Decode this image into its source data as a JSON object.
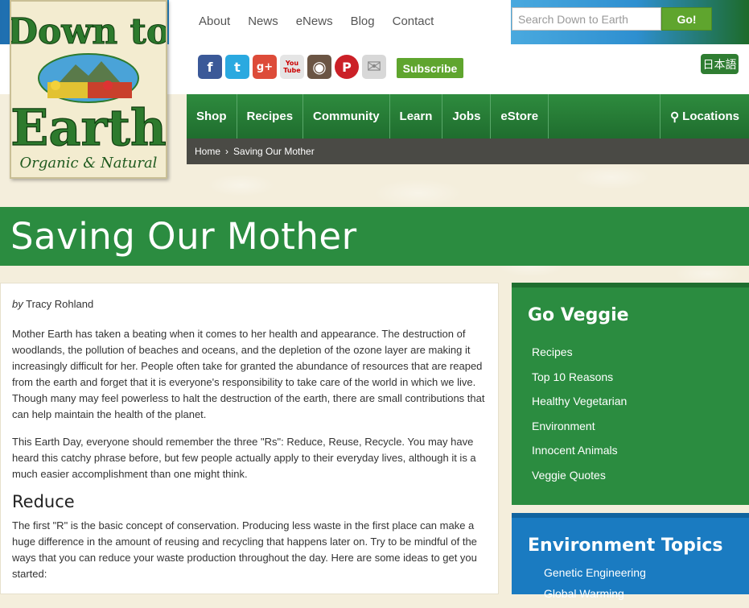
{
  "header": {
    "logo": {
      "line1": "Down to",
      "line2": "Earth",
      "tagline": "Organic & Natural"
    },
    "topnav": [
      "About",
      "News",
      "eNews",
      "Blog",
      "Contact"
    ],
    "search": {
      "placeholder": "Search Down to Earth",
      "button": "Go!"
    },
    "socials": [
      {
        "icon": "facebook-icon",
        "glyph": "f",
        "color": "#3b5998"
      },
      {
        "icon": "twitter-icon",
        "glyph": "t",
        "color": "#2aa9e0"
      },
      {
        "icon": "google-plus-icon",
        "glyph": "g+",
        "color": "#dd4b39"
      },
      {
        "icon": "youtube-icon",
        "glyph": "You Tube",
        "color": "#e5e5e5"
      },
      {
        "icon": "instagram-icon",
        "glyph": "◉",
        "color": "#6b5544"
      },
      {
        "icon": "pinterest-icon",
        "glyph": "P",
        "color": "#cb2027"
      },
      {
        "icon": "email-icon",
        "glyph": "✉",
        "color": "#d8d8d8"
      }
    ],
    "subscribe": "Subscribe",
    "language": "日本語"
  },
  "mainnav": {
    "items": [
      "Shop",
      "Recipes",
      "Community",
      "Learn",
      "Jobs",
      "eStore"
    ],
    "locations": "Locations"
  },
  "breadcrumb": {
    "home": "Home",
    "current": "Saving Our Mother"
  },
  "page": {
    "title": "Saving Our Mother",
    "by": "by",
    "author": "Tracy Rohland",
    "paragraphs": [
      "Mother Earth has taken a beating when it comes to her health and appearance. The destruction of woodlands, the pollution of beaches and oceans, and the depletion of the ozone layer are making it increasingly difficult for her. People often take for granted the abundance of resources that are reaped from the earth and forget that it is everyone's responsibility to take care of the world in which we live. Though many may feel powerless to halt the destruction of the earth, there are small contributions that can help maintain the health of the planet.",
      "This Earth Day, everyone should remember the three \"Rs\": Reduce, Reuse, Recycle. You may have heard this catchy phrase before, but few people actually apply to their everyday lives, although it is a much easier accomplishment than one might think."
    ],
    "section_heading": "Reduce",
    "section_paragraph": "The first \"R\" is the basic concept of conservation. Producing less waste in the first place can make a huge difference in the amount of reusing and recycling that happens later on. Try to be mindful of the ways that you can reduce your waste production throughout the day. Here are some ideas to get you started:"
  },
  "sidebar": {
    "go_veggie": {
      "title": "Go Veggie",
      "links": [
        "Recipes",
        "Top 10 Reasons",
        "Healthy Vegetarian",
        "Environment",
        "Innocent Animals",
        "Veggie Quotes"
      ]
    },
    "environment": {
      "title": "Environment Topics",
      "links": [
        "Genetic Engineering",
        "Global Warming"
      ]
    }
  },
  "colors": {
    "green": "#2b8c40",
    "blue": "#1a7bc1",
    "button_green": "#5fa52e"
  }
}
